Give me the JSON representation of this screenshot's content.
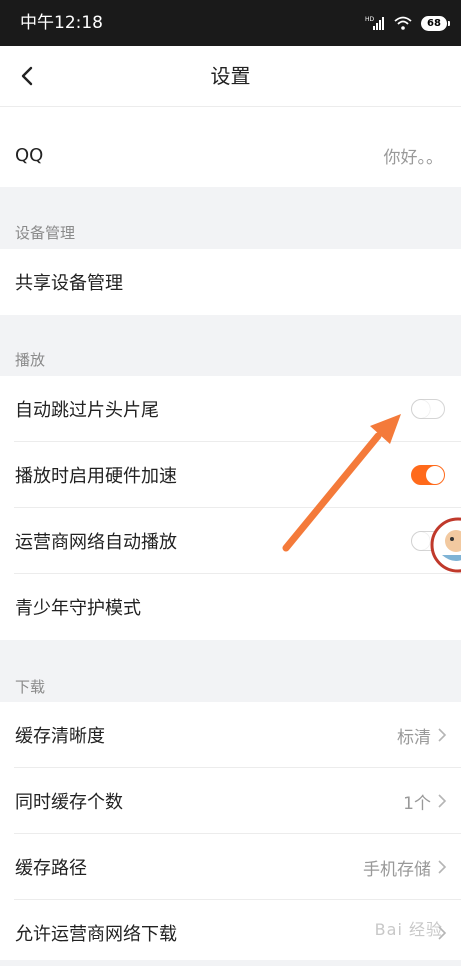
{
  "status_bar": {
    "time": "中午12:18",
    "network": "HD",
    "battery": "68"
  },
  "header": {
    "title": "设置"
  },
  "account": {
    "label": "QQ",
    "value": "你好。。"
  },
  "device_section": {
    "title": "设备管理",
    "items": [
      {
        "label": "共享设备管理"
      }
    ]
  },
  "play_section": {
    "title": "播放",
    "items": [
      {
        "label": "自动跳过片头片尾",
        "toggle_on": false
      },
      {
        "label": "播放时启用硬件加速",
        "toggle_on": true
      },
      {
        "label": "运营商网络自动播放",
        "toggle_on": false
      },
      {
        "label": "青少年守护模式"
      }
    ]
  },
  "download_section": {
    "title": "下载",
    "items": [
      {
        "label": "缓存清晰度",
        "value": "标清"
      },
      {
        "label": "同时缓存个数",
        "value": "1个"
      },
      {
        "label": "缓存路径",
        "value": "手机存储"
      },
      {
        "label": "允许运营商网络下载"
      }
    ]
  },
  "watermark": "Bai 经验",
  "colors": {
    "accent": "#ff6a1b",
    "arrow": "#f47a3a"
  },
  "icons": [
    "back-arrow-icon",
    "chevron-right-icon",
    "signal-icon",
    "wifi-icon",
    "battery-icon",
    "annotation-arrow",
    "mascot-icon"
  ]
}
